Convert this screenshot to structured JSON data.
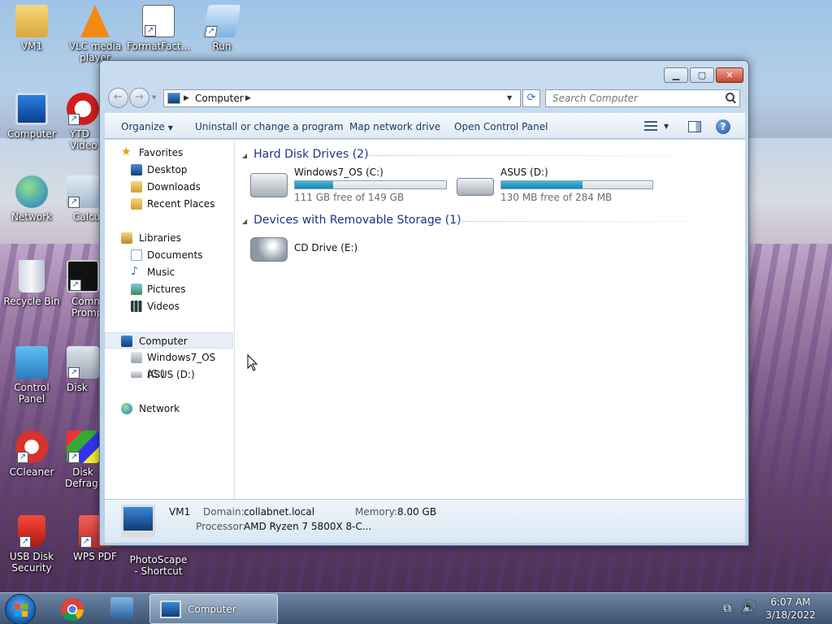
{
  "desktop": {
    "icons": [
      {
        "label": "VM1"
      },
      {
        "label": "VLC media player"
      },
      {
        "label": "FormatFact..."
      },
      {
        "label": "Run"
      },
      {
        "label": "Computer"
      },
      {
        "label": "YTD Video Downloader"
      },
      {
        "label": "Network"
      },
      {
        "label": "Calculator"
      },
      {
        "label": "Recycle Bin"
      },
      {
        "label": "Command Prompt"
      },
      {
        "label": "Control Panel"
      },
      {
        "label": "Disk Cleanup"
      },
      {
        "label": "CCleaner"
      },
      {
        "label": "Disk Defragmenter"
      },
      {
        "label": "USB Disk Security"
      },
      {
        "label": "WPS PDF"
      },
      {
        "label": "PhotoScape - Shortcut"
      }
    ]
  },
  "window": {
    "address": {
      "location": "Computer"
    },
    "search": {
      "placeholder": "Search Computer"
    },
    "toolbar": {
      "organize": "Organize",
      "uninstall": "Uninstall or change a program",
      "map_drive": "Map network drive",
      "control_panel": "Open Control Panel"
    },
    "sidebar": {
      "favorites": "Favorites",
      "desktop": "Desktop",
      "downloads": "Downloads",
      "recent": "Recent Places",
      "libraries": "Libraries",
      "documents": "Documents",
      "music": "Music",
      "pictures": "Pictures",
      "videos": "Videos",
      "computer": "Computer",
      "drive_c": "Windows7_OS (C:)",
      "drive_d": "ASUS (D:)",
      "network": "Network"
    },
    "groups": {
      "hdd": "Hard Disk Drives (2)",
      "removable": "Devices with Removable Storage (1)"
    },
    "drives": [
      {
        "name": "Windows7_OS (C:)",
        "free": "111 GB free of 149 GB",
        "used_fraction": 0.255
      },
      {
        "name": "ASUS (D:)",
        "free": "130 MB free of 284 MB",
        "used_fraction": 0.54
      },
      {
        "name": "CD Drive (E:)"
      }
    ],
    "details": {
      "name": "VM1",
      "domain_label": "Domain:",
      "domain": "collabnet.local",
      "memory_label": "Memory:",
      "memory": "8.00 GB",
      "processor_label": "Processor:",
      "processor": "AMD Ryzen 7 5800X 8-C..."
    }
  },
  "taskbar": {
    "active_window": "Computer",
    "time": "6:07 AM",
    "date": "3/18/2022"
  },
  "colors": {
    "accent": "#1e3287",
    "progress": "#26a0c8",
    "close": "#c9442c"
  }
}
